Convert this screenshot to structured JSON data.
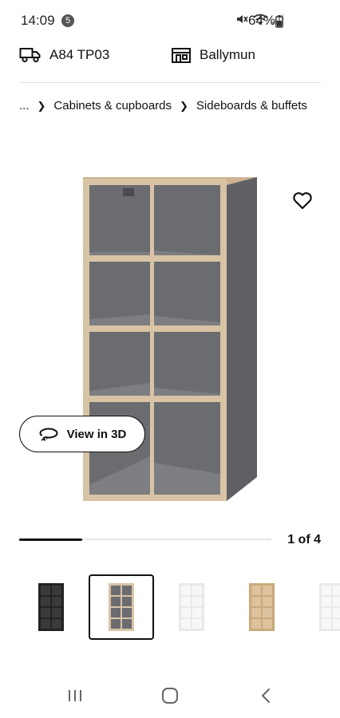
{
  "status_bar": {
    "time": "14:09",
    "notification_count": "5",
    "battery": "64%",
    "icons": [
      "mute-icon",
      "wifi-icon",
      "signal-icon",
      "battery-icon"
    ]
  },
  "delivery": {
    "postcode": "A84 TP03",
    "store": "Ballymun",
    "icons": [
      "truck-icon",
      "store-icon"
    ]
  },
  "breadcrumb": {
    "ellipsis": "...",
    "items": [
      "Cabinets & cupboards",
      "Sideboards & buffets"
    ]
  },
  "product": {
    "image": "grey-wood-effect-shelving-unit",
    "favourite_icon": "heart-icon"
  },
  "view3d": {
    "label": "View in 3D",
    "icon": "rotate-3d-icon"
  },
  "gallery": {
    "counter": "1 of 4",
    "progress_fraction": 0.25,
    "thumbnails": [
      {
        "variant": "black-brown",
        "selected": false
      },
      {
        "variant": "grey-wood-effect",
        "selected": true
      },
      {
        "variant": "white",
        "selected": false
      },
      {
        "variant": "oak-effect",
        "selected": false
      },
      {
        "variant": "white-partial",
        "selected": false
      }
    ]
  },
  "nav_bar": {
    "buttons": [
      "recent-apps-icon",
      "home-icon",
      "back-icon"
    ]
  },
  "colors": {
    "text": "#111111",
    "grey_unit": "#6b6d70",
    "wood": "#d9c4a6",
    "track": "#e4e4e4"
  }
}
